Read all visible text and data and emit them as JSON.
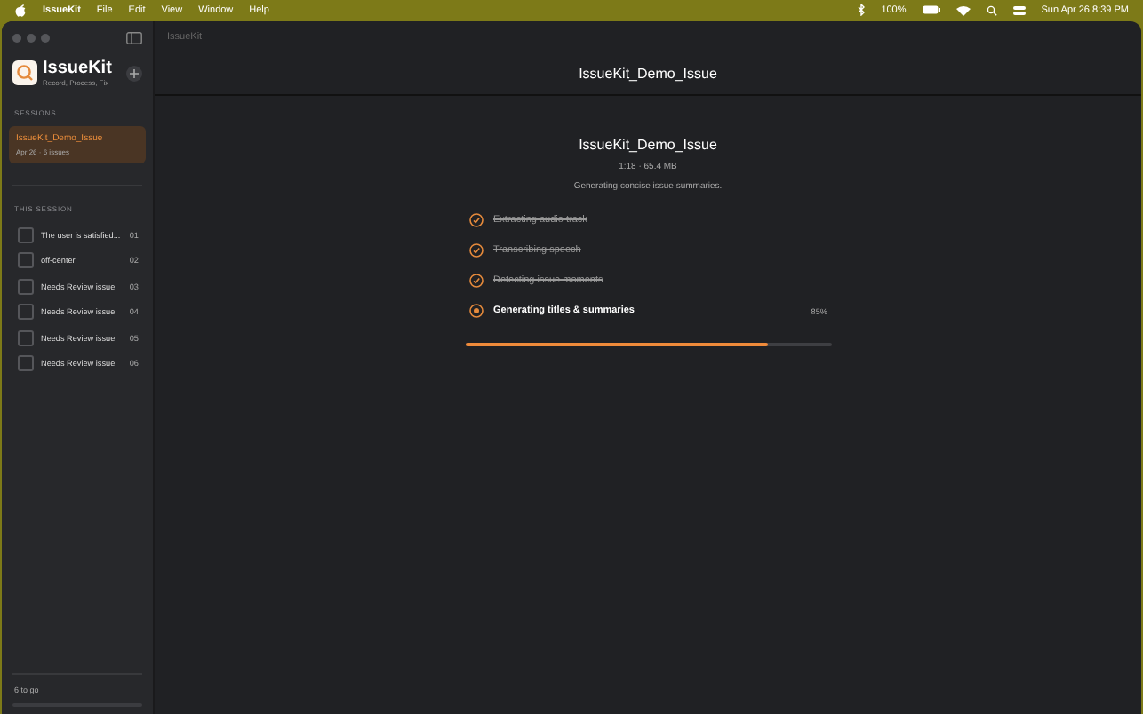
{
  "menu_bar": {
    "app": "IssueKit",
    "items": [
      "File",
      "Edit",
      "View",
      "Window",
      "Help"
    ],
    "battery": "100%",
    "clock": "Sun Apr 26  8:39 PM"
  },
  "window": {
    "title": "IssueKit"
  },
  "sidebar": {
    "app_name": "IssueKit",
    "tagline": "Record, Process, Fix",
    "sessions_heading": "SESSIONS",
    "sessions": [
      {
        "name": "IssueKit_Demo_Issue",
        "meta": "Apr 26 · 6 issues",
        "selected": true
      }
    ],
    "this_session_heading": "THIS SESSION",
    "issues": [
      {
        "title": "The user is satisfied...",
        "number": "01",
        "checked": false
      },
      {
        "title": "off-center",
        "number": "02",
        "checked": false
      },
      {
        "title": "Needs Review issue",
        "number": "03",
        "checked": false
      },
      {
        "title": "Needs Review issue",
        "number": "04",
        "checked": false
      },
      {
        "title": "Needs Review issue",
        "number": "05",
        "checked": false
      },
      {
        "title": "Needs Review issue",
        "number": "06",
        "checked": false
      }
    ],
    "footer": "6 to go"
  },
  "main": {
    "header": "IssueKit_Demo_Issue",
    "title": "IssueKit_Demo_Issue",
    "meta": "1:18 · 65.4 MB",
    "status": "Generating concise issue summaries.",
    "steps": [
      {
        "label": "Extracting audio track",
        "done": true
      },
      {
        "label": "Transcribing speech",
        "done": true
      },
      {
        "label": "Detecting issue moments",
        "done": true
      },
      {
        "label": "Generating titles & summaries",
        "done": false,
        "percent": "85%"
      }
    ],
    "progress": {
      "level": 0.83
    }
  }
}
